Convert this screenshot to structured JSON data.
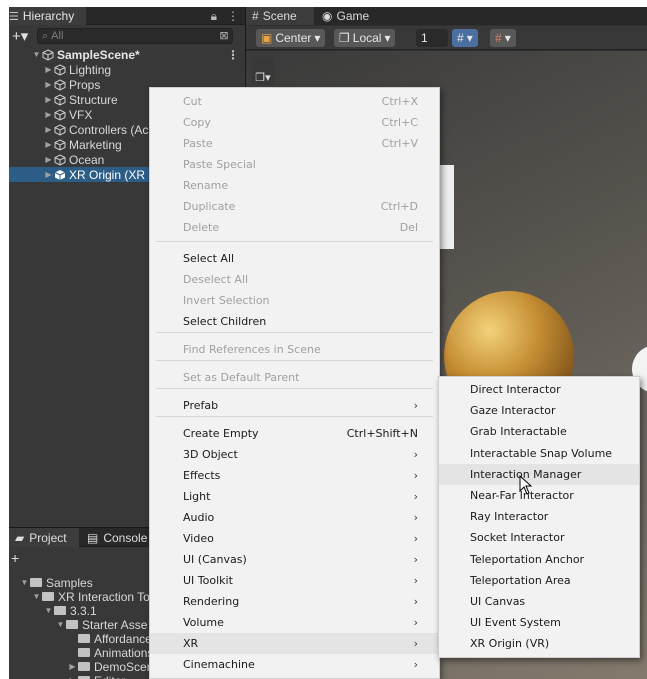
{
  "hierarchy": {
    "tab_label": "Hierarchy",
    "search_placeholder": "All",
    "items": [
      {
        "label": "SampleScene*",
        "depth": 0,
        "expanded": true
      },
      {
        "label": "Lighting",
        "depth": 1
      },
      {
        "label": "Props",
        "depth": 1
      },
      {
        "label": "Structure",
        "depth": 1
      },
      {
        "label": "VFX",
        "depth": 1
      },
      {
        "label": "Controllers (Ac",
        "depth": 1
      },
      {
        "label": "Marketing",
        "depth": 1
      },
      {
        "label": "Ocean",
        "depth": 1
      },
      {
        "label": "XR Origin (XR R",
        "depth": 1,
        "selected": true
      }
    ]
  },
  "scene": {
    "tabs": [
      "Scene",
      "Game"
    ],
    "center_label": "Center",
    "local_label": "Local",
    "grid_value": "1"
  },
  "project": {
    "tabs": [
      "Project",
      "Console"
    ],
    "items": [
      {
        "label": "Samples",
        "depth": 0
      },
      {
        "label": "XR Interaction Too",
        "depth": 1
      },
      {
        "label": "3.3.1",
        "depth": 2
      },
      {
        "label": "Starter Asse",
        "depth": 3
      },
      {
        "label": "Affordance",
        "depth": 4
      },
      {
        "label": "Animations",
        "depth": 4
      },
      {
        "label": "DemoScer",
        "depth": 4
      },
      {
        "label": "Editor",
        "depth": 4
      }
    ]
  },
  "context_menu": {
    "items": [
      {
        "label": "Cut",
        "shortcut": "Ctrl+X",
        "disabled": true
      },
      {
        "label": "Copy",
        "shortcut": "Ctrl+C",
        "disabled": true
      },
      {
        "label": "Paste",
        "shortcut": "Ctrl+V",
        "disabled": true
      },
      {
        "label": "Paste Special",
        "shortcut": "",
        "disabled": true
      },
      {
        "label": "Rename",
        "shortcut": "",
        "disabled": true
      },
      {
        "label": "Duplicate",
        "shortcut": "Ctrl+D",
        "disabled": true
      },
      {
        "label": "Delete",
        "shortcut": "Del",
        "disabled": true
      },
      {
        "label": "Select All",
        "shortcut": "",
        "disabled": false
      },
      {
        "label": "Deselect All",
        "shortcut": "",
        "disabled": true
      },
      {
        "label": "Invert Selection",
        "shortcut": "",
        "disabled": true
      },
      {
        "label": "Select Children",
        "shortcut": "",
        "disabled": false
      },
      {
        "label": "Find References in Scene",
        "shortcut": "",
        "disabled": true
      },
      {
        "label": "Set as Default Parent",
        "shortcut": "",
        "disabled": true
      },
      {
        "label": "Prefab",
        "shortcut": "",
        "submenu": true
      },
      {
        "label": "Create Empty",
        "shortcut": "Ctrl+Shift+N"
      },
      {
        "label": "3D Object",
        "shortcut": "",
        "submenu": true
      },
      {
        "label": "Effects",
        "shortcut": "",
        "submenu": true
      },
      {
        "label": "Light",
        "shortcut": "",
        "submenu": true
      },
      {
        "label": "Audio",
        "shortcut": "",
        "submenu": true
      },
      {
        "label": "Video",
        "shortcut": "",
        "submenu": true
      },
      {
        "label": "UI (Canvas)",
        "shortcut": "",
        "submenu": true
      },
      {
        "label": "UI Toolkit",
        "shortcut": "",
        "submenu": true
      },
      {
        "label": "Rendering",
        "shortcut": "",
        "submenu": true
      },
      {
        "label": "Volume",
        "shortcut": "",
        "submenu": true
      },
      {
        "label": "XR",
        "shortcut": "",
        "submenu": true,
        "hover": true
      },
      {
        "label": "Cinemachine",
        "shortcut": "",
        "submenu": true
      }
    ]
  },
  "xr_submenu": {
    "items": [
      "Direct Interactor",
      "Gaze Interactor",
      "Grab Interactable",
      "Interactable Snap Volume",
      "Interaction Manager",
      "Near-Far Interactor",
      "Ray Interactor",
      "Socket Interactor",
      "Teleportation Anchor",
      "Teleportation Area",
      "UI Canvas",
      "UI Event System",
      "XR Origin (VR)"
    ],
    "hover_index": 4
  },
  "colors": {
    "selection": "#2c5d87",
    "menu_bg": "#f2f2f2",
    "menu_disabled": "#a0a0a0"
  }
}
